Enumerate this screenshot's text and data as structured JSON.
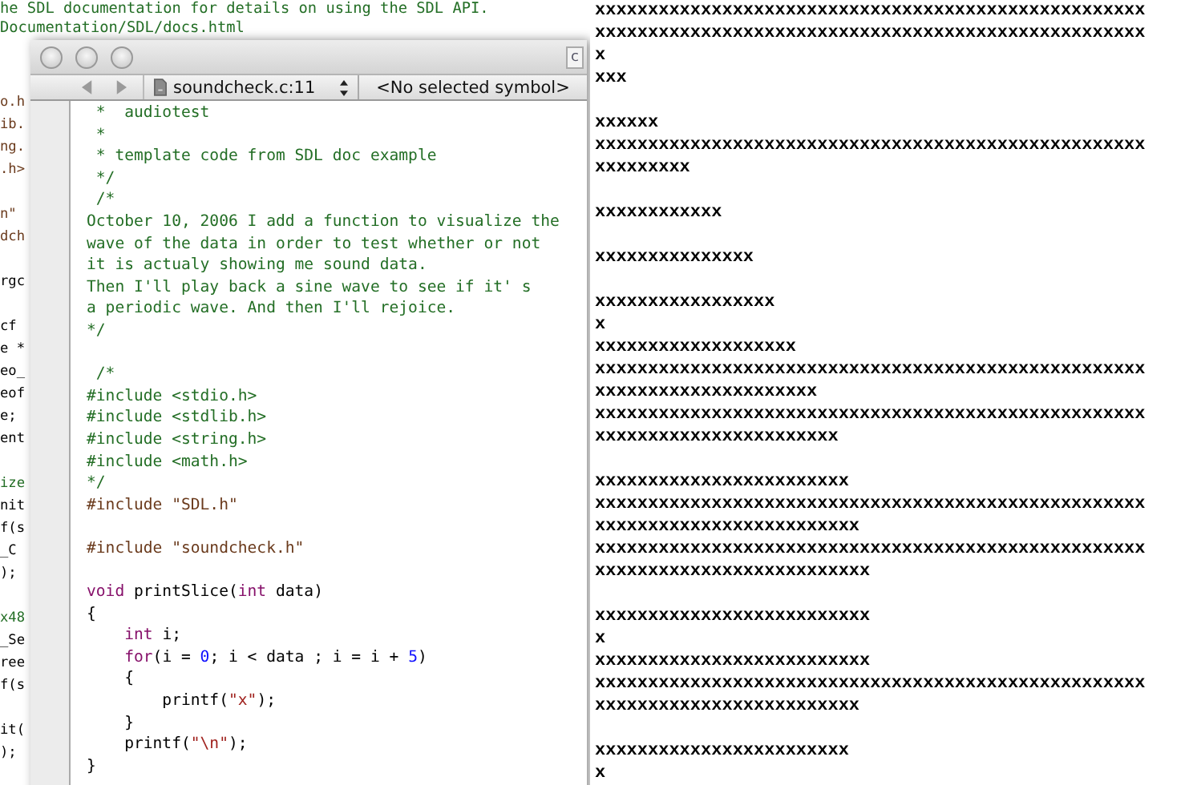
{
  "background_editor": {
    "top_lines": [
      "he SDL documentation for details on using the SDL API.",
      "Documentation/SDL/docs.html"
    ],
    "fragment_blocks": [
      [
        {
          "text": "o.h",
          "kind": "preprocessor"
        },
        {
          "text": "ib.",
          "kind": "preprocessor"
        },
        {
          "text": "ng.",
          "kind": "preprocessor"
        },
        {
          "text": ".h>",
          "kind": "preprocessor"
        }
      ],
      [
        {
          "text": "n\"",
          "kind": "preprocessor"
        },
        {
          "text": "dch",
          "kind": "preprocessor"
        }
      ],
      [
        {
          "text": "rgc",
          "kind": "plain"
        }
      ],
      [
        {
          "text": "cf",
          "kind": "plain"
        },
        {
          "text": "e *",
          "kind": "plain"
        },
        {
          "text": "eo_",
          "kind": "plain"
        },
        {
          "text": "eof",
          "kind": "plain"
        },
        {
          "text": "e;",
          "kind": "plain"
        },
        {
          "text": "ent",
          "kind": "plain"
        }
      ],
      [
        {
          "text": "ize",
          "kind": "comment"
        },
        {
          "text": "nit",
          "kind": "plain"
        },
        {
          "text": "f(s",
          "kind": "plain"
        },
        {
          "text": "_C",
          "kind": "plain"
        },
        {
          "text": ");",
          "kind": "plain"
        }
      ],
      [
        {
          "text": "x48",
          "kind": "comment"
        },
        {
          "text": "_Se",
          "kind": "plain"
        },
        {
          "text": "ree",
          "kind": "plain"
        },
        {
          "text": "f(s",
          "kind": "plain"
        }
      ],
      [
        {
          "text": "it(",
          "kind": "plain"
        },
        {
          "text": ");",
          "kind": "plain"
        }
      ]
    ]
  },
  "editor": {
    "title_icon_letter": "c",
    "file_popup": "soundcheck.c:11",
    "symbol_popup": "<No selected symbol>",
    "code_blocks": [
      [
        [
          {
            "kind": "comment",
            "text": " *  audiotest"
          }
        ],
        [
          {
            "kind": "comment",
            "text": " *"
          }
        ],
        [
          {
            "kind": "comment",
            "text": " * template code from SDL doc example"
          }
        ],
        [
          {
            "kind": "comment",
            "text": " */"
          }
        ],
        [
          {
            "kind": "comment",
            "text": " /*"
          }
        ],
        [
          {
            "kind": "comment",
            "text": "October 10, 2006 I add a function to visualize the"
          }
        ],
        [
          {
            "kind": "comment",
            "text": "wave of the data in order to test whether or not"
          }
        ],
        [
          {
            "kind": "comment",
            "text": "it is actualy showing me sound data."
          }
        ],
        [
          {
            "kind": "comment",
            "text": "Then I'll play back a sine wave to see if it' s"
          }
        ],
        [
          {
            "kind": "comment",
            "text": "a periodic wave. And then I'll rejoice."
          }
        ],
        [
          {
            "kind": "comment",
            "text": "*/"
          }
        ]
      ],
      [
        [
          {
            "kind": "comment",
            "text": " /*"
          }
        ],
        [
          {
            "kind": "comment",
            "text": "#include <stdio.h>"
          }
        ],
        [
          {
            "kind": "comment",
            "text": "#include <stdlib.h>"
          }
        ],
        [
          {
            "kind": "comment",
            "text": "#include <string.h>"
          }
        ],
        [
          {
            "kind": "comment",
            "text": "#include <math.h>"
          }
        ],
        [
          {
            "kind": "comment",
            "text": "*/"
          }
        ],
        [
          {
            "kind": "preprocessor",
            "text": "#include \"SDL.h\""
          }
        ]
      ],
      [
        [
          {
            "kind": "preprocessor",
            "text": "#include \"soundcheck.h\""
          }
        ]
      ],
      [
        [
          {
            "kind": "keyword",
            "text": "void"
          },
          {
            "kind": "plain",
            "text": " printSlice("
          },
          {
            "kind": "keyword",
            "text": "int"
          },
          {
            "kind": "plain",
            "text": " data)"
          }
        ],
        [
          {
            "kind": "plain",
            "text": "{"
          }
        ],
        [
          {
            "kind": "keyword",
            "text": "    int"
          },
          {
            "kind": "plain",
            "text": " i;"
          }
        ],
        [
          {
            "kind": "keyword",
            "text": "    for"
          },
          {
            "kind": "plain",
            "text": "(i = "
          },
          {
            "kind": "number",
            "text": "0"
          },
          {
            "kind": "plain",
            "text": "; i < data ; i = i + "
          },
          {
            "kind": "number",
            "text": "5"
          },
          {
            "kind": "plain",
            "text": ")"
          }
        ],
        [
          {
            "kind": "plain",
            "text": "    {"
          }
        ],
        [
          {
            "kind": "plain",
            "text": "        printf("
          },
          {
            "kind": "string",
            "text": "\"x\""
          },
          {
            "kind": "plain",
            "text": ");"
          }
        ],
        [
          {
            "kind": "plain",
            "text": "    }"
          }
        ],
        [
          {
            "kind": "plain",
            "text": "    printf("
          },
          {
            "kind": "string",
            "text": "\"\\n\""
          },
          {
            "kind": "plain",
            "text": ");"
          }
        ],
        [
          {
            "kind": "plain",
            "text": "}"
          }
        ]
      ]
    ]
  },
  "output": {
    "blocks": [
      [
        "xxxxxxxxxxxxxxxxxxxxxxxxxxxxxxxxxxxxxxxxxxxxxxxxxxxx",
        "xxxxxxxxxxxxxxxxxxxxxxxxxxxxxxxxxxxxxxxxxxxxxxxxxxxx",
        "x",
        "xxx"
      ],
      [
        "xxxxxx",
        "xxxxxxxxxxxxxxxxxxxxxxxxxxxxxxxxxxxxxxxxxxxxxxxxxxxx",
        "xxxxxxxxx"
      ],
      [
        "xxxxxxxxxxxx"
      ],
      [
        "xxxxxxxxxxxxxxx"
      ],
      [
        "xxxxxxxxxxxxxxxxx",
        "x",
        "xxxxxxxxxxxxxxxxxxx",
        "xxxxxxxxxxxxxxxxxxxxxxxxxxxxxxxxxxxxxxxxxxxxxxxxxxxx",
        "xxxxxxxxxxxxxxxxxxxxx",
        "xxxxxxxxxxxxxxxxxxxxxxxxxxxxxxxxxxxxxxxxxxxxxxxxxxxx",
        "xxxxxxxxxxxxxxxxxxxxxxx"
      ],
      [
        "xxxxxxxxxxxxxxxxxxxxxxxx",
        "xxxxxxxxxxxxxxxxxxxxxxxxxxxxxxxxxxxxxxxxxxxxxxxxxxxx",
        "xxxxxxxxxxxxxxxxxxxxxxxxx",
        "xxxxxxxxxxxxxxxxxxxxxxxxxxxxxxxxxxxxxxxxxxxxxxxxxxxx",
        "xxxxxxxxxxxxxxxxxxxxxxxxxx"
      ],
      [
        "xxxxxxxxxxxxxxxxxxxxxxxxxx",
        "x",
        "xxxxxxxxxxxxxxxxxxxxxxxxxx",
        "xxxxxxxxxxxxxxxxxxxxxxxxxxxxxxxxxxxxxxxxxxxxxxxxxxxx",
        "xxxxxxxxxxxxxxxxxxxxxxxxx"
      ],
      [
        "xxxxxxxxxxxxxxxxxxxxxxxx",
        "x"
      ]
    ]
  }
}
